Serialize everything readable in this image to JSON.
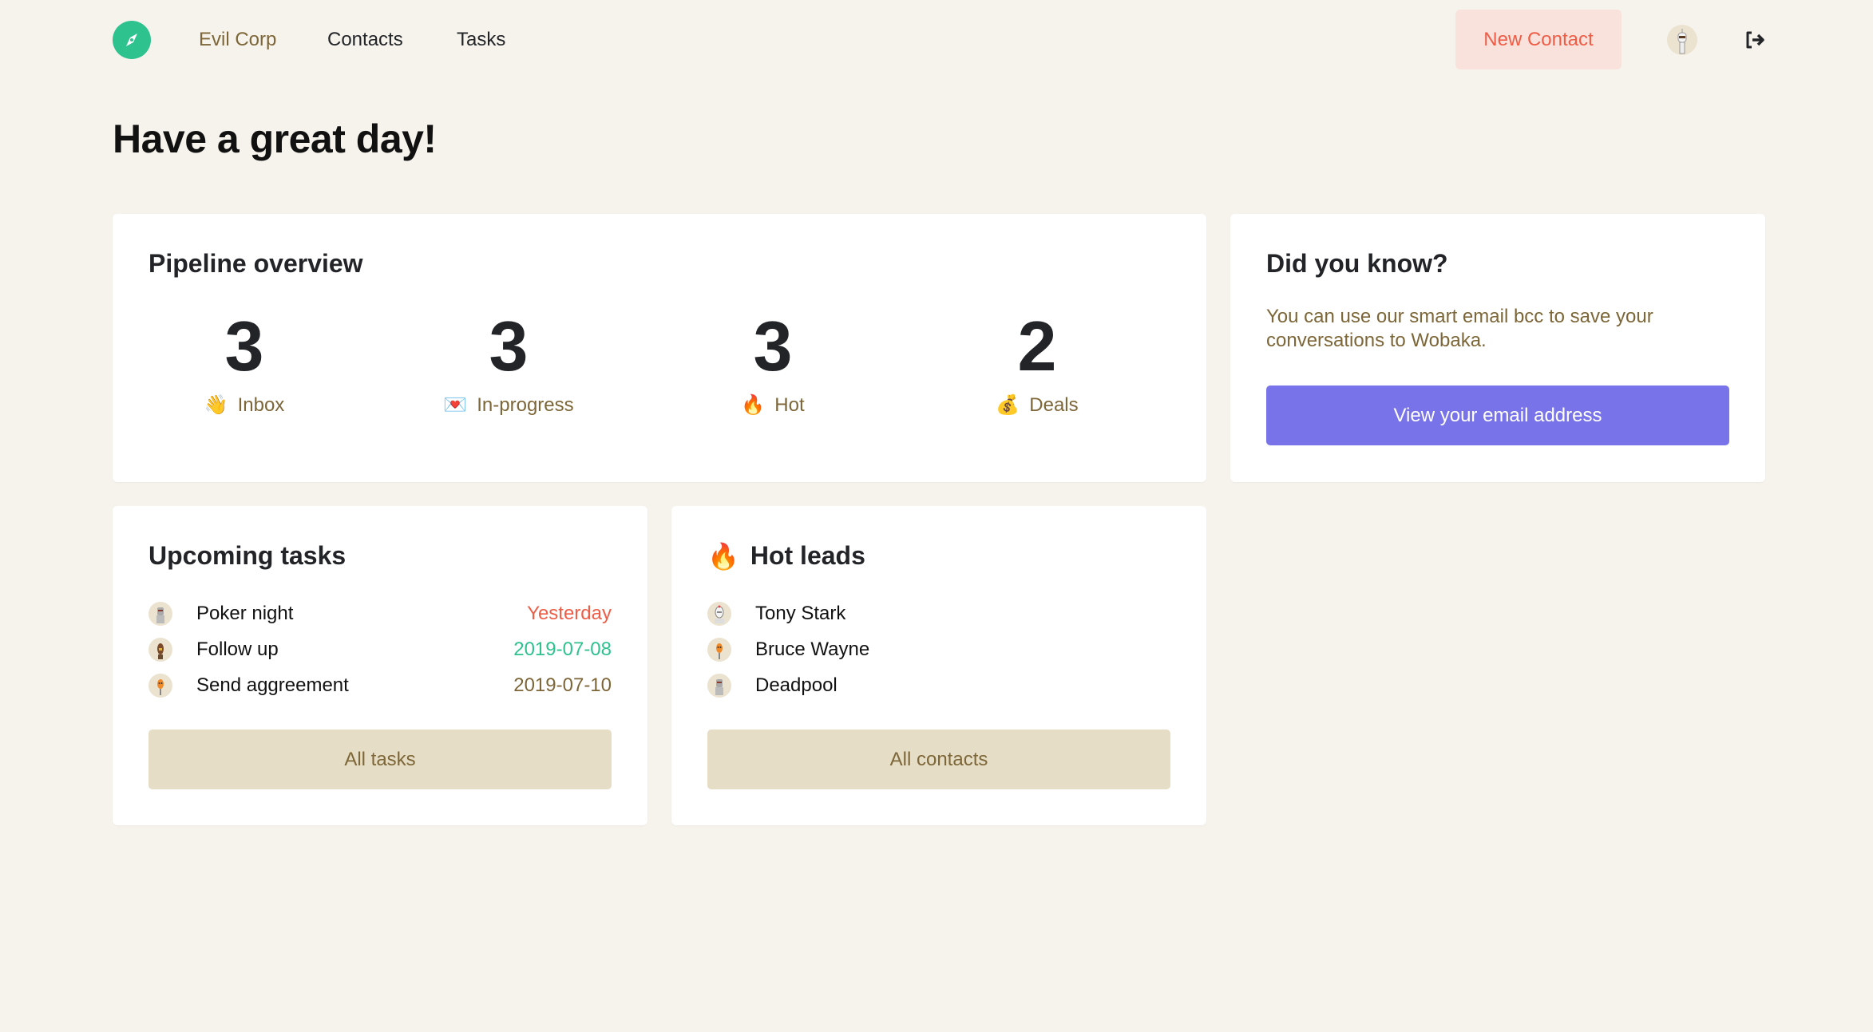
{
  "header": {
    "logo_icon": "compass-icon",
    "nav": [
      {
        "label": "Evil Corp"
      },
      {
        "label": "Contacts"
      },
      {
        "label": "Tasks"
      }
    ],
    "new_contact_label": "New Contact",
    "user_avatar_icon": "robot-avatar",
    "logout_icon": "sign-out-icon"
  },
  "page": {
    "title": "Have a great day!"
  },
  "pipeline": {
    "title": "Pipeline overview",
    "stats": [
      {
        "value": "3",
        "label": "Inbox",
        "emoji": "👋",
        "icon": "waving-hand-icon"
      },
      {
        "value": "3",
        "label": "In-progress",
        "emoji": "💌",
        "icon": "love-letter-icon"
      },
      {
        "value": "3",
        "label": "Hot",
        "emoji": "🔥",
        "icon": "fire-icon"
      },
      {
        "value": "2",
        "label": "Deals",
        "emoji": "💰",
        "icon": "money-bag-icon"
      }
    ]
  },
  "tip": {
    "title": "Did you know?",
    "text": "You can use our smart email bcc to save your conversations to Wobaka.",
    "button_label": "View your email address"
  },
  "tasks": {
    "title": "Upcoming tasks",
    "items": [
      {
        "name": "Poker night",
        "date": "Yesterday",
        "date_color": "#f05d47"
      },
      {
        "name": "Follow up",
        "date": "2019-07-08",
        "date_color": "#2ec28f"
      },
      {
        "name": "Send aggreement",
        "date": "2019-07-10",
        "date_color": "#7d6637"
      }
    ],
    "button_label": "All tasks"
  },
  "leads": {
    "title": "Hot leads",
    "title_emoji": "🔥",
    "items": [
      {
        "name": "Tony Stark"
      },
      {
        "name": "Bruce Wayne"
      },
      {
        "name": "Deadpool"
      }
    ],
    "button_label": "All contacts"
  },
  "colors": {
    "background": "#f6f3ec",
    "brand_green": "#2ec28f",
    "accent_purple": "#7873e8",
    "danger": "#f05d47",
    "muted_brown": "#7d6637",
    "secondary_button": "#e5ddc6"
  }
}
